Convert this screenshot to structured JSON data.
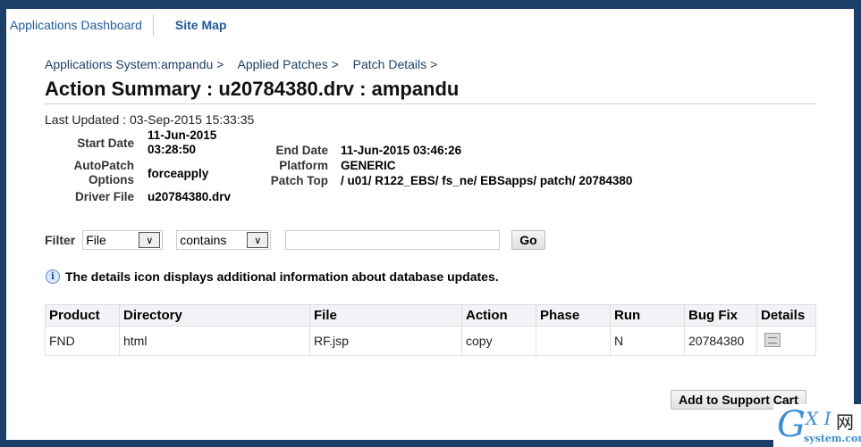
{
  "nav": {
    "dashboard": "Applications Dashboard",
    "sitemap": "Site Map"
  },
  "breadcrumbs": [
    "Applications System:ampandu >",
    "Applied Patches >",
    "Patch Details >"
  ],
  "title": "Action Summary : u20784380.drv : ampandu",
  "last_updated": "Last Updated : 03-Sep-2015 15:33:35",
  "details": {
    "start_date_label": "Start Date",
    "start_date": "11-Jun-2015 03:28:50",
    "autopatch_label": "AutoPatch Options",
    "autopatch": "forceapply",
    "driver_label": "Driver File",
    "driver": "u20784380.drv",
    "end_date_label": "End Date",
    "end_date": "11-Jun-2015 03:46:26",
    "platform_label": "Platform",
    "platform": "GENERIC",
    "patch_top_label": "Patch Top",
    "patch_top": "/ u01/ R122_EBS/ fs_ne/ EBSapps/ patch/ 20784380"
  },
  "filter": {
    "label": "Filter",
    "field": "File",
    "operator": "contains",
    "value": "",
    "go": "Go"
  },
  "info": "The details icon displays additional information about database updates.",
  "table": {
    "headers": [
      "Product",
      "Directory",
      "File",
      "Action",
      "Phase",
      "Run",
      "Bug Fix",
      "Details"
    ],
    "rows": [
      [
        "FND",
        "html",
        "RF.jsp",
        "copy",
        "",
        "N",
        "20784380"
      ]
    ]
  },
  "add_cart": "Add to Support Cart",
  "watermark": "GXI网 system.com"
}
